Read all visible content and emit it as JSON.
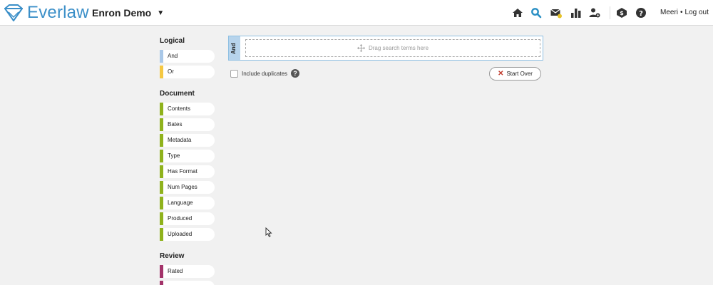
{
  "header": {
    "brand": "Everlaw",
    "project": "Enron Demo",
    "user": "Meeri",
    "logout": "Log out",
    "icons": [
      "home-icon",
      "search-icon",
      "messages-icon",
      "analytics-icon",
      "admin-icon",
      "alerts-icon",
      "help-icon"
    ]
  },
  "sidebar": {
    "groups": [
      {
        "title": "Logical",
        "items": [
          {
            "label": "And",
            "color": "#a9c8e8"
          },
          {
            "label": "Or",
            "color": "#f5c842"
          }
        ]
      },
      {
        "title": "Document",
        "items": [
          {
            "label": "Contents",
            "color": "#8fb21c"
          },
          {
            "label": "Bates",
            "color": "#8fb21c"
          },
          {
            "label": "Metadata",
            "color": "#8fb21c"
          },
          {
            "label": "Type",
            "color": "#8fb21c"
          },
          {
            "label": "Has Format",
            "color": "#8fb21c"
          },
          {
            "label": "Num Pages",
            "color": "#8fb21c"
          },
          {
            "label": "Language",
            "color": "#8fb21c"
          },
          {
            "label": "Produced",
            "color": "#8fb21c"
          },
          {
            "label": "Uploaded",
            "color": "#8fb21c"
          }
        ]
      },
      {
        "title": "Review",
        "items": [
          {
            "label": "Rated",
            "color": "#a3336a"
          }
        ]
      }
    ]
  },
  "builder": {
    "operator": "And",
    "placeholder": "Drag search terms here",
    "include_duplicates": "Include duplicates",
    "start_over": "Start Over"
  }
}
